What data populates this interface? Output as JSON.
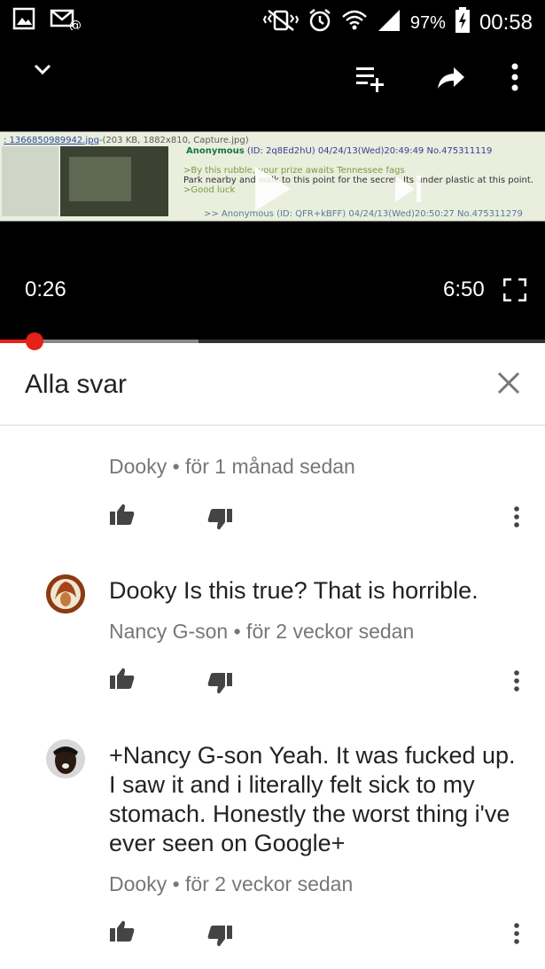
{
  "status_bar": {
    "battery": "97%",
    "time": "00:58",
    "icons": [
      "gallery-icon",
      "mail-at-icon",
      "vibrate-icon",
      "alarm-icon",
      "wifi-icon",
      "signal-icon",
      "battery-charging-icon"
    ]
  },
  "player": {
    "icons": [
      "chevron-down-icon",
      "add-to-queue-icon",
      "share-icon",
      "more-vert-icon",
      "play-icon",
      "skip-next-icon",
      "fullscreen-icon"
    ],
    "current_time": "0:26",
    "duration": "6:50",
    "progress_fraction": 0.063,
    "buffered_fraction": 0.364,
    "thumbnail": {
      "link": ": 1366850989942.jpg",
      "file_info": "-(203 KB, 1882x810, Capture.jpg)",
      "post1_name": "Anonymous",
      "post1_meta": "(ID: 2q8Ed2hU) 04/24/13(Wed)20:49:49 No.475311119",
      "line1": ">By this rubble, your prize awaits Tennessee fags",
      "line2": "Park nearby and walk to this point for the secret. Its under plastic at this point.",
      "line3": ">Good luck",
      "post2": ">> Anonymous (ID: QFR+kBFF) 04/24/13(Wed)20:50:27 No.475311279"
    }
  },
  "panel": {
    "title": "Alla svar",
    "close_icon": "close-icon"
  },
  "comments": [
    {
      "text": "",
      "meta": "Dooky • för 1 månad sedan"
    },
    {
      "text": "Dooky Is this true? That is horrible.",
      "meta": "Nancy G-son • för 2 veckor sedan"
    },
    {
      "text": "+Nancy G-son Yeah. It was fucked up. I saw it and i literally felt sick to my stomach. Honestly the worst thing i've ever seen on Google+",
      "meta": "Dooky • för 2 veckor sedan"
    }
  ]
}
